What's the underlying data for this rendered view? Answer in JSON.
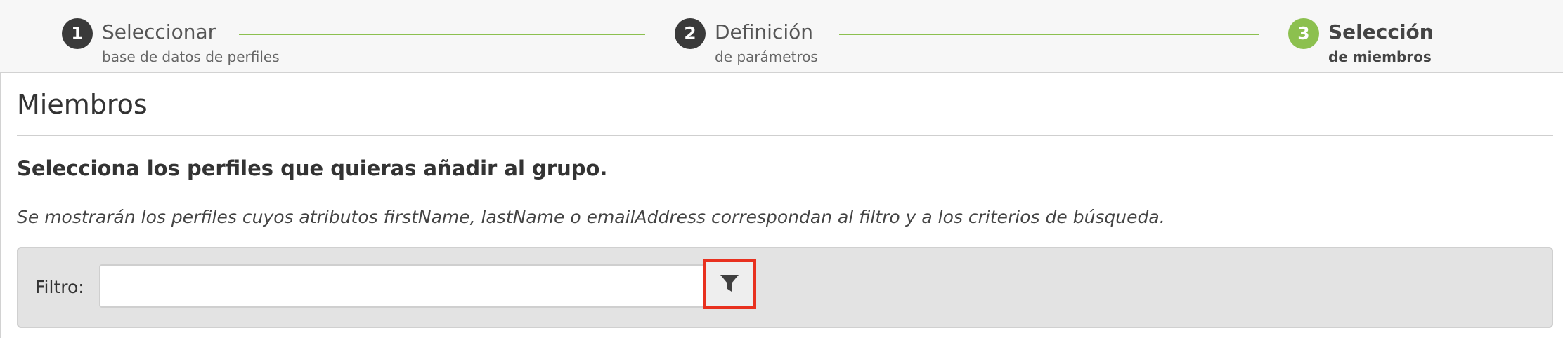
{
  "wizard": {
    "steps": [
      {
        "number": "1",
        "title": "Seleccionar",
        "subtitle": "base de datos de perfiles",
        "active": false
      },
      {
        "number": "2",
        "title": "Definición",
        "subtitle": "de parámetros",
        "active": false
      },
      {
        "number": "3",
        "title": "Selección",
        "subtitle": "de miembros",
        "active": true
      }
    ]
  },
  "main": {
    "title": "Miembros",
    "instruction": "Selecciona los perfiles que quieras añadir al grupo.",
    "hint": "Se mostrarán los perfiles cuyos atributos firstName, lastName o emailAddress correspondan al filtro y a los criterios de búsqueda.",
    "filter": {
      "label": "Filtro:",
      "value": "",
      "placeholder": "",
      "button_icon": "filter-icon"
    }
  },
  "colors": {
    "accent": "#8cc04f",
    "step_inactive": "#3a3a3a",
    "highlight": "#e8311f"
  }
}
